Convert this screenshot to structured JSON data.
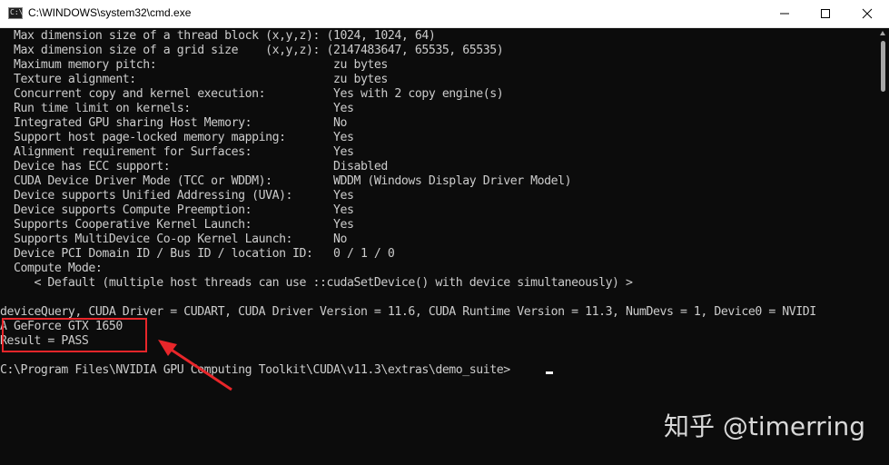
{
  "window": {
    "title": "C:\\WINDOWS\\system32\\cmd.exe",
    "icon": "cmd-icon",
    "icon_text": "C:\\"
  },
  "console": {
    "lines": [
      "  Max dimension size of a thread block (x,y,z): (1024, 1024, 64)",
      "  Max dimension size of a grid size    (x,y,z): (2147483647, 65535, 65535)",
      "  Maximum memory pitch:                          zu bytes",
      "  Texture alignment:                             zu bytes",
      "  Concurrent copy and kernel execution:          Yes with 2 copy engine(s)",
      "  Run time limit on kernels:                     Yes",
      "  Integrated GPU sharing Host Memory:            No",
      "  Support host page-locked memory mapping:       Yes",
      "  Alignment requirement for Surfaces:            Yes",
      "  Device has ECC support:                        Disabled",
      "  CUDA Device Driver Mode (TCC or WDDM):         WDDM (Windows Display Driver Model)",
      "  Device supports Unified Addressing (UVA):      Yes",
      "  Device supports Compute Preemption:            Yes",
      "  Supports Cooperative Kernel Launch:            Yes",
      "  Supports MultiDevice Co-op Kernel Launch:      No",
      "  Device PCI Domain ID / Bus ID / location ID:   0 / 1 / 0",
      "  Compute Mode:",
      "     < Default (multiple host threads can use ::cudaSetDevice() with device simultaneously) >",
      "",
      "deviceQuery, CUDA Driver = CUDART, CUDA Driver Version = 11.6, CUDA Runtime Version = 11.3, NumDevs = 1, Device0 = NVIDI",
      "A GeForce GTX 1650",
      "Result = PASS",
      "",
      "C:\\Program Files\\NVIDIA GPU Computing Toolkit\\CUDA\\v11.3\\extras\\demo_suite>"
    ]
  },
  "annotation": {
    "highlight_color": "#e8262a"
  },
  "watermark": {
    "text": "知乎 @timerring"
  },
  "colors": {
    "background": "#0c0c0c",
    "text": "#cccccc",
    "titlebar": "#ffffff"
  }
}
